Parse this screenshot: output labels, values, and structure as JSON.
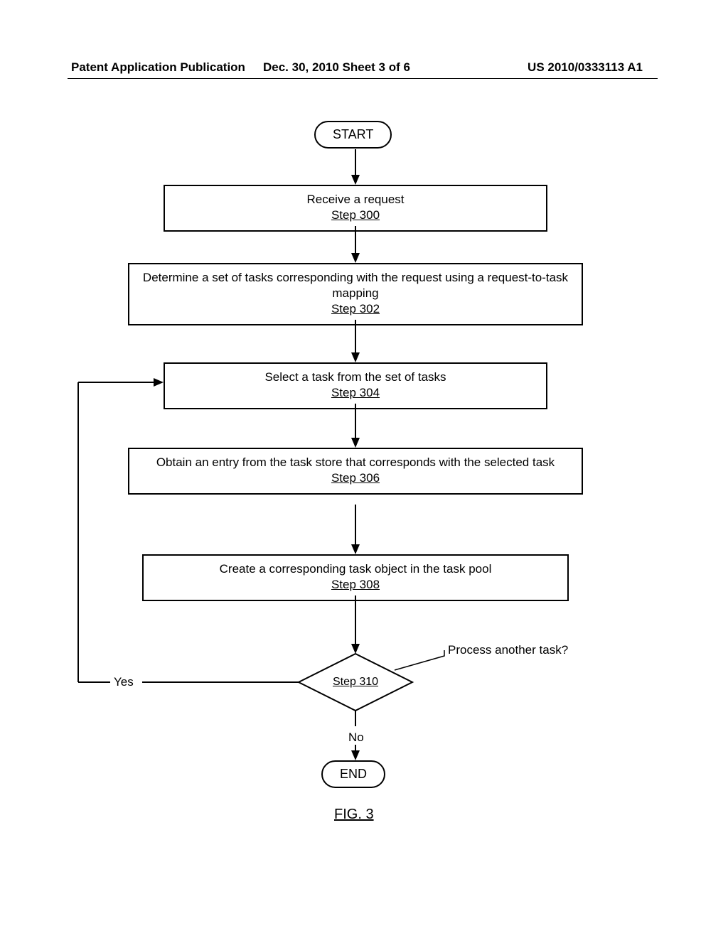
{
  "header": {
    "left": "Patent Application Publication",
    "center": "Dec. 30, 2010  Sheet 3 of 6",
    "right": "US 2010/0333113 A1"
  },
  "flow": {
    "start": "START",
    "end": "END",
    "step300": {
      "text": "Receive a request",
      "label": "Step 300"
    },
    "step302": {
      "text": "Determine a set of tasks corresponding with the request using a request-to-task mapping",
      "label": "Step 302"
    },
    "step304": {
      "text": "Select a task from the set of tasks",
      "label": "Step 304"
    },
    "step306": {
      "text": "Obtain an entry from the task store that corresponds with the selected task",
      "label": "Step 306"
    },
    "step308": {
      "text": "Create a corresponding task object in the task pool",
      "label": "Step 308"
    },
    "step310": {
      "label": "Step 310",
      "question": "Process another task?",
      "yes": "Yes",
      "no": "No"
    }
  },
  "figure": "FIG. 3"
}
